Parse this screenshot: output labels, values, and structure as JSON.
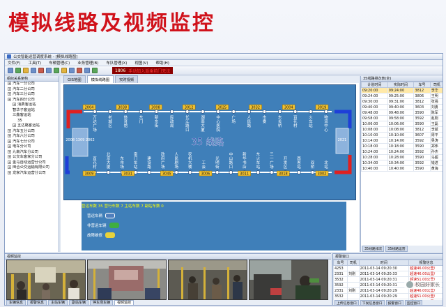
{
  "slide_title": "模拟线路及视频监控",
  "app": {
    "window_title": "公交智能运营调度系统 - [模拟线路图]",
    "menu": [
      "文件(F)",
      "工具(T)",
      "车辆管理(C)",
      "业务管理(B)",
      "车队管理(X)",
      "视图(V)",
      "帮助(H)"
    ],
    "alarm": {
      "id": "1806",
      "message": "手动加入返乘前门无法"
    }
  },
  "left_tree": {
    "header": "组织关系架构",
    "items": [
      {
        "label": "汽车一分公司",
        "indent": 0,
        "plus": true
      },
      {
        "label": "汽车二分公司",
        "indent": 0,
        "plus": true
      },
      {
        "label": "汽车三分公司",
        "indent": 0,
        "plus": true
      },
      {
        "label": "汽车四分公司",
        "indent": 0,
        "plus": true
      },
      {
        "label": "消费客运站",
        "indent": 1,
        "plus": true
      },
      {
        "label": "智华子客运站",
        "indent": 1,
        "plus": false
      },
      {
        "label": "三鑫客运站",
        "indent": 1,
        "plus": false
      },
      {
        "label": "35",
        "indent": 2,
        "plus": false
      },
      {
        "label": "五达路客运站",
        "indent": 1,
        "plus": true
      },
      {
        "label": "汽车五分公司",
        "indent": 0,
        "plus": true
      },
      {
        "label": "汽车六分公司",
        "indent": 0,
        "plus": true
      },
      {
        "label": "汽车七分公司",
        "indent": 0,
        "plus": true
      },
      {
        "label": "电车分公司",
        "indent": 0,
        "plus": true
      },
      {
        "label": "九南汽车分公司",
        "indent": 0,
        "plus": true
      },
      {
        "label": "公交车客家分公司",
        "indent": 0,
        "plus": true
      },
      {
        "label": "金马自动运营分公司",
        "indent": 0,
        "plus": true
      },
      {
        "label": "田合公交运输有限公司",
        "indent": 0,
        "plus": true
      },
      {
        "label": "龙家汽车运营分公司",
        "indent": 0,
        "plus": true
      }
    ]
  },
  "center": {
    "tabs": [
      "GIS地图",
      "模拟线路图",
      "实时视频"
    ],
    "active_tab": 1,
    "route_name": "35 线路",
    "left_terminal": "2008 1309 2062",
    "right_terminal": "2021",
    "top_stops": [
      "万达广场",
      "老城区",
      "体育馆",
      "东门",
      "新东街",
      "民政局",
      "长江路口",
      "湖南大厦",
      "中心医院",
      "广场",
      "人民路",
      "市委",
      "东关桥",
      "百花村",
      "火车站",
      "物流中心"
    ],
    "bottom_stops": [
      "百花村",
      "北京大厦",
      "东市场",
      "南门车站",
      "建设路",
      "政府广场",
      "人民剧场",
      "农机大楼",
      "工会",
      "光明街",
      "中山路口",
      "新华书店",
      "东火车站",
      "三一广场",
      "开发区",
      "西客站",
      "双桥",
      "北站"
    ],
    "top_buses": [
      "2004",
      "3038",
      "3008",
      "3012",
      "3025",
      "3032",
      "3004",
      "3019"
    ],
    "bottom_buses": [
      "3009",
      "3031",
      "3045",
      "3006",
      "3011",
      "3018",
      "3002"
    ],
    "legend_line": "营运车数 35 营行车数 7 主站车数 7 副站车数 0",
    "legend": [
      {
        "label": "营运车辆",
        "color": "#4f7fbd"
      },
      {
        "label": "非营运车辆",
        "color": "#3fae3f"
      },
      {
        "label": "故障维修",
        "color": "#e8d23b"
      }
    ]
  },
  "right_table": {
    "header": "35线路排次表(全)",
    "columns": [
      "计划时间",
      "实际时间",
      "车号",
      "司机"
    ],
    "rows": [
      [
        "09:20:00",
        "09:24:00",
        "3812",
        "李华"
      ],
      [
        "09:24:00",
        "09:25:00",
        "3806",
        "王明"
      ],
      [
        "09:30:00",
        "09:31:00",
        "3812",
        "张强"
      ],
      [
        "09:40:00",
        "09:40:00",
        "3603",
        "刘勇"
      ],
      [
        "09:48:00",
        "09:48:00",
        "3590",
        "陈军"
      ],
      [
        "09:58:00",
        "09:58:00",
        "3592",
        "赵刚"
      ],
      [
        "10:06:00",
        "10:06:00",
        "3590",
        "王磊"
      ],
      [
        "10:08:00",
        "10:08:00",
        "3812",
        "李斌"
      ],
      [
        "10:10:00",
        "10:10:00",
        "3607",
        "周平"
      ],
      [
        "10:14:00",
        "10:14:00",
        "3592",
        "吴涛"
      ],
      [
        "10:18:00",
        "10:18:00",
        "3590",
        "郑伟"
      ],
      [
        "10:24:00",
        "10:24:00",
        "3592",
        "孙杰"
      ],
      [
        "10:28:00",
        "10:28:00",
        "3590",
        "马超"
      ],
      [
        "10:34:00",
        "10:34:00",
        "3592",
        "钱进"
      ],
      [
        "10:40:00",
        "10:40:00",
        "3590",
        "黄海"
      ]
    ],
    "bottom_tabs": [
      "35线路排次",
      "35线路运营"
    ]
  },
  "video_panel": {
    "header": "视频监控",
    "tabs": [
      "车辆信息",
      "报警信息",
      "主站车辆",
      "副站车辆",
      "停车场车辆",
      "视频监控"
    ],
    "active_tab": 5
  },
  "alarm_panel": {
    "header": "报警窗口",
    "columns": [
      "车号",
      "司机",
      "时间",
      "报警信息"
    ],
    "rows": [
      [
        "4253",
        "",
        "2011-03-14 09:20:30",
        "超速46.00公里/"
      ],
      [
        "2331",
        "刘刚",
        "2011-03-14 09:20:33",
        "超速46.00公里/"
      ],
      [
        "3532",
        "",
        "2011-03-14 09:20:31",
        "超速51.00公里/"
      ],
      [
        "3592",
        "",
        "2011-03-14 09:20:31",
        "超速51.00公里/"
      ],
      [
        "2331",
        "刘刚",
        "2011-03-14 09:20:29",
        "超速46.00公里/"
      ],
      [
        "3532",
        "",
        "2011-03-14 09:20:29",
        "超速51.00公里/"
      ],
      [
        "4253",
        "",
        "2011-03-14 09:20:29",
        "超速46.00公里/"
      ],
      [
        "F003",
        "",
        "2011-03-14 09:20:28",
        "超速46.00公里/"
      ],
      [
        "F003",
        "",
        "2011-03-14 09:20:27",
        "超速46.00公里/"
      ]
    ],
    "bottom_tabs": [
      "上传信息窗口",
      "下发信息窗口",
      "报警窗口",
      "监控窗口"
    ]
  },
  "watermark": "校园好家长"
}
